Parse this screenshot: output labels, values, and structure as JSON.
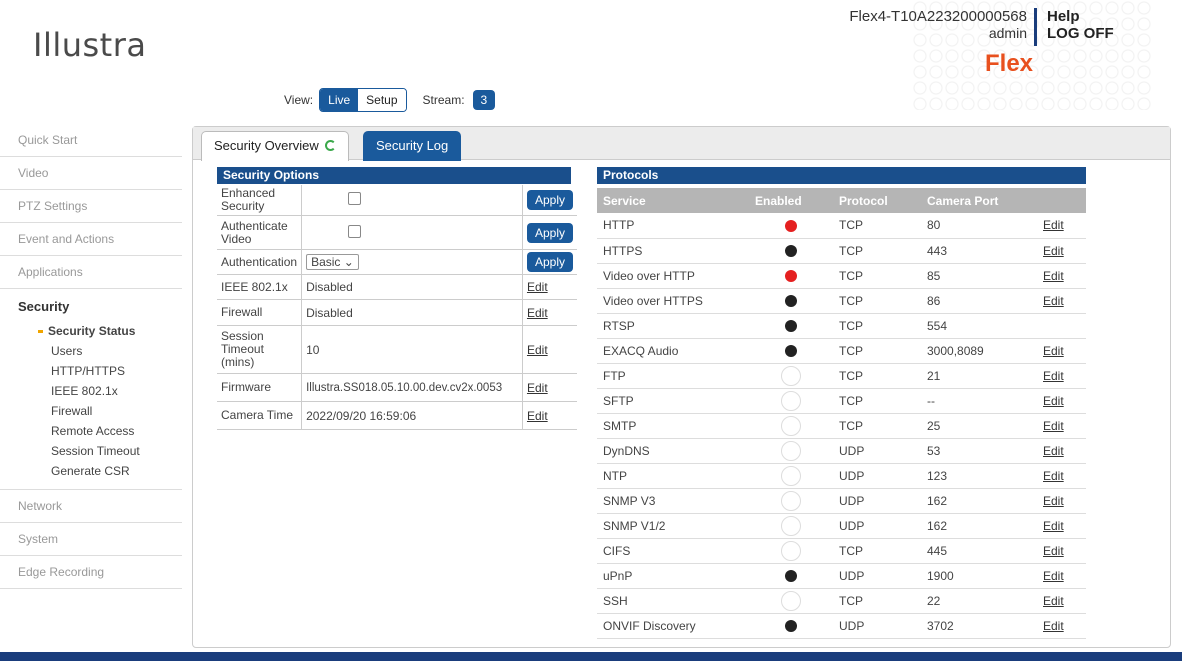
{
  "header": {
    "logo": "Illustra",
    "device_name": "Flex4-T10A223200000568",
    "user": "admin",
    "help": "Help",
    "logoff": "LOG OFF",
    "product": "Flex",
    "view_label": "View:",
    "view_live": "Live",
    "view_setup": "Setup",
    "stream_label": "Stream:",
    "stream_value": "3"
  },
  "sidebar": {
    "items_top": [
      "Quick Start",
      "Video",
      "PTZ Settings",
      "Event and Actions",
      "Applications"
    ],
    "section": "Security",
    "sub_items": [
      "Security Status",
      "Users",
      "HTTP/HTTPS",
      "IEEE 802.1x",
      "Firewall",
      "Remote Access",
      "Session Timeout",
      "Generate CSR"
    ],
    "items_bottom": [
      "Network",
      "System",
      "Edge Recording"
    ]
  },
  "tabs": {
    "overview": "Security Overview",
    "log": "Security Log"
  },
  "options": {
    "title": "Security Options",
    "apply": "Apply",
    "edit": "Edit",
    "enhanced_label": "Enhanced Security",
    "auth_video_label": "Authenticate Video",
    "auth_label": "Authentication",
    "auth_value": "Basic",
    "ieee_label": "IEEE 802.1x",
    "ieee_value": "Disabled",
    "firewall_label": "Firewall",
    "firewall_value": "Disabled",
    "session_label": "Session Timeout (mins)",
    "session_value": "10",
    "firmware_label": "Firmware",
    "firmware_value": "Illustra.SS018.05.10.00.dev.cv2x.0053",
    "camtime_label": "Camera Time",
    "camtime_value": "2022/09/20 16:59:06"
  },
  "protocols": {
    "title": "Protocols",
    "columns": [
      "Service",
      "Enabled",
      "Protocol",
      "Camera Port"
    ],
    "rows": [
      {
        "service": "HTTP",
        "enabled": "red",
        "protocol": "TCP",
        "port": "80",
        "edit": "Edit"
      },
      {
        "service": "HTTPS",
        "enabled": "black",
        "protocol": "TCP",
        "port": "443",
        "edit": "Edit"
      },
      {
        "service": "Video over HTTP",
        "enabled": "red",
        "protocol": "TCP",
        "port": "85",
        "edit": "Edit"
      },
      {
        "service": "Video over HTTPS",
        "enabled": "black",
        "protocol": "TCP",
        "port": "86",
        "edit": "Edit"
      },
      {
        "service": "RTSP",
        "enabled": "black",
        "protocol": "TCP",
        "port": "554",
        "edit": ""
      },
      {
        "service": "EXACQ Audio",
        "enabled": "black",
        "protocol": "TCP",
        "port": "3000,8089",
        "edit": "Edit"
      },
      {
        "service": "FTP",
        "enabled": "off",
        "protocol": "TCP",
        "port": "21",
        "edit": "Edit"
      },
      {
        "service": "SFTP",
        "enabled": "off",
        "protocol": "TCP",
        "port": "--",
        "edit": "Edit"
      },
      {
        "service": "SMTP",
        "enabled": "off",
        "protocol": "TCP",
        "port": "25",
        "edit": "Edit"
      },
      {
        "service": "DynDNS",
        "enabled": "off",
        "protocol": "UDP",
        "port": "53",
        "edit": "Edit"
      },
      {
        "service": "NTP",
        "enabled": "off",
        "protocol": "UDP",
        "port": "123",
        "edit": "Edit"
      },
      {
        "service": "SNMP V3",
        "enabled": "off",
        "protocol": "UDP",
        "port": "162",
        "edit": "Edit"
      },
      {
        "service": "SNMP V1/2",
        "enabled": "off",
        "protocol": "UDP",
        "port": "162",
        "edit": "Edit"
      },
      {
        "service": "CIFS",
        "enabled": "off",
        "protocol": "TCP",
        "port": "445",
        "edit": "Edit"
      },
      {
        "service": "uPnP",
        "enabled": "black",
        "protocol": "UDP",
        "port": "1900",
        "edit": "Edit"
      },
      {
        "service": "SSH",
        "enabled": "off",
        "protocol": "TCP",
        "port": "22",
        "edit": "Edit"
      },
      {
        "service": "ONVIF Discovery",
        "enabled": "black",
        "protocol": "UDP",
        "port": "3702",
        "edit": "Edit"
      }
    ]
  },
  "colors": {
    "brand_blue": "#1a5a9c",
    "header_blue": "#1a4f8c",
    "flex_orange": "#e8501e",
    "status_red": "#e52020"
  }
}
